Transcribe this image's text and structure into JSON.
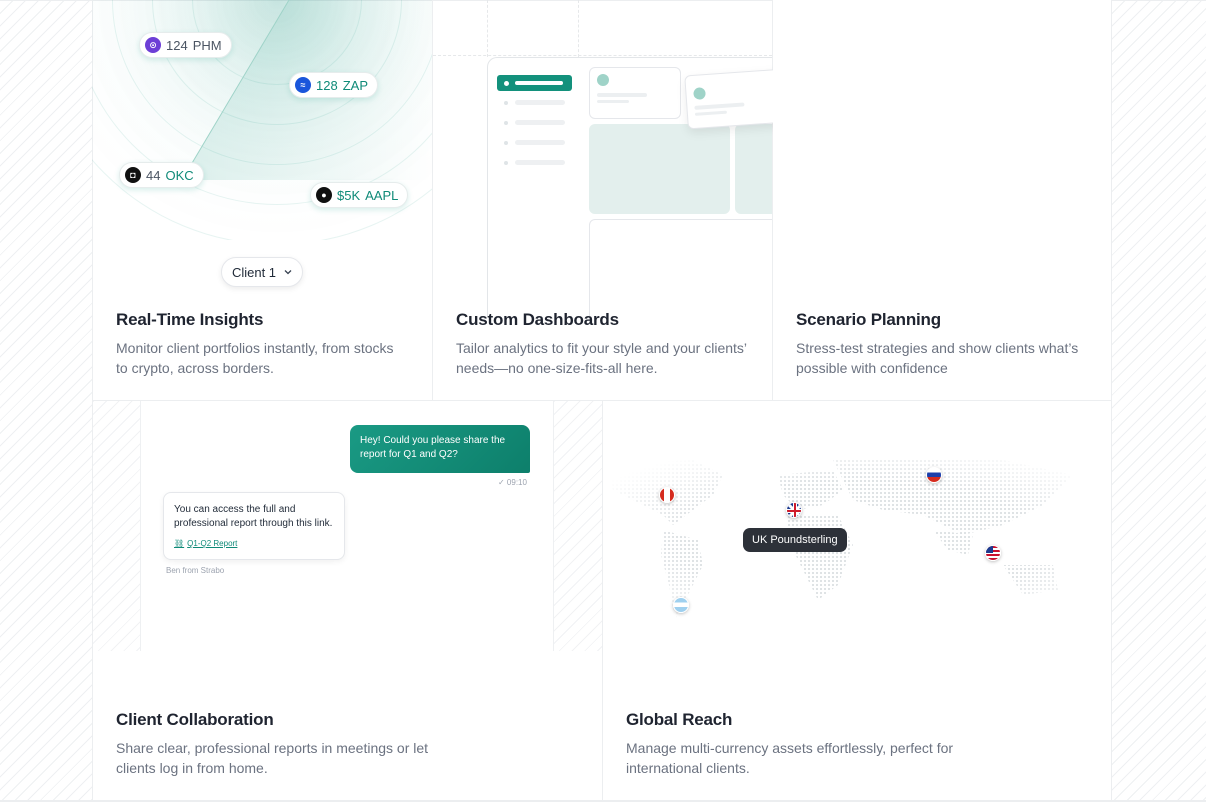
{
  "insights": {
    "title": "Real-Time Insights",
    "description_line1": "Monitor client portfolios instantly, from stocks",
    "description_line2": "to crypto, across borders.",
    "tickers": [
      {
        "count": "124",
        "symbol": "PHM",
        "icon": "phm-logo-icon",
        "color": "#6d3fd6"
      },
      {
        "count": "128",
        "symbol": "ZAP",
        "icon": "zap-logo-icon",
        "color": "#1a56db"
      },
      {
        "count": "44",
        "symbol": "OKC",
        "icon": "okc-logo-icon",
        "color": "#111111"
      },
      {
        "count": "$5K",
        "symbol": "AAPL",
        "icon": "apple-logo-icon",
        "color": "#111111"
      }
    ],
    "client_select": {
      "value": "Client 1"
    }
  },
  "dashboards": {
    "title": "Custom Dashboards",
    "description_line1": "Tailor analytics to fit your style and your clients’",
    "description_line2": "needs—no one-size-fits-all here."
  },
  "scenario": {
    "title": "Scenario Planning",
    "description_line1": "Stress-test strategies and show clients what’s",
    "description_line2": "possible with confidence"
  },
  "collaboration": {
    "title": "Client Collaboration",
    "description_line1": "Share clear, professional reports in meetings or let",
    "description_line2": "clients log in from home.",
    "chat": {
      "outgoing_line1": "Hey! Could you please share the",
      "outgoing_line2": "report for Q1 and Q2?",
      "outgoing_time": "✓ 09:10",
      "incoming_line1": "You can access the full and",
      "incoming_line2": "professional report through this link.",
      "incoming_link": "Q1-Q2 Report",
      "sender": "Ben from Strabo"
    }
  },
  "global": {
    "title": "Global Reach",
    "description_line1": "Manage multi-currency assets effortlessly, perfect for",
    "description_line2": "international clients.",
    "currency_tooltip": "UK Poundsterling",
    "flags": [
      "canada-flag-icon",
      "uk-flag-icon",
      "russia-flag-icon",
      "usa-flag-icon",
      "argentina-flag-icon"
    ]
  },
  "colors": {
    "accent": "#13917c",
    "title_text": "#1f2430",
    "body_text": "#6b7280"
  }
}
